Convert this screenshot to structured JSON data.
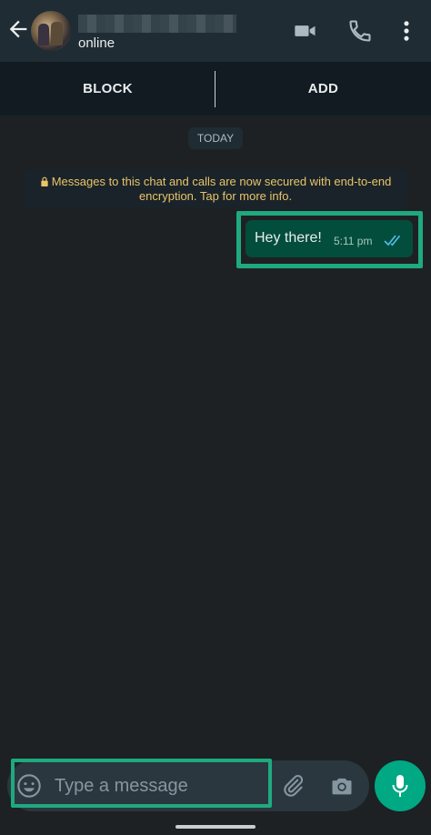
{
  "header": {
    "status": "online"
  },
  "actions": {
    "block_label": "BLOCK",
    "add_label": "ADD"
  },
  "chat": {
    "date_chip": "TODAY",
    "encryption_line1": "Messages to this chat and calls are now secured with end-to-end",
    "encryption_line2": "encryption. Tap for more info.",
    "messages": [
      {
        "text": "Hey there!",
        "time": "5:11 pm",
        "status": "read"
      }
    ]
  },
  "composer": {
    "placeholder": "Type a message"
  },
  "icons": {
    "back": "arrow-left-icon",
    "video": "video-call-icon",
    "call": "phone-icon",
    "menu": "more-vertical-icon",
    "lock": "lock-icon",
    "ticks": "double-check-icon",
    "emoji": "emoji-icon",
    "attach": "paperclip-icon",
    "camera": "camera-icon",
    "mic": "microphone-icon"
  },
  "colors": {
    "header_bg": "#1f2c33",
    "chat_bg": "#1d2124",
    "bubble_out": "#034d3c",
    "accent": "#00a884",
    "highlight": "#1fa97f",
    "read_ticks": "#53bdeb"
  }
}
